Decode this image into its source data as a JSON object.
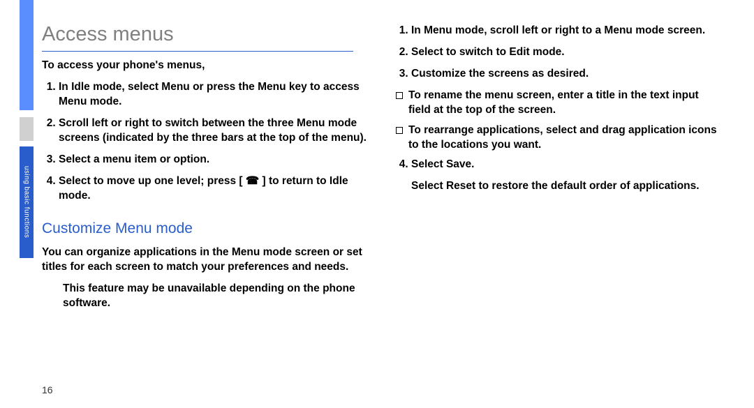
{
  "sideTab": "using basic functions",
  "pageNumber": "16",
  "left": {
    "heading": "Access menus",
    "intro": "To access your phone's menus,",
    "steps": [
      "In Idle mode, select Menu or press the Menu key to access Menu mode.",
      "Scroll left or right to switch between the three Menu mode screens (indicated by the three bars at the top of the menu).",
      "Select a menu item or option.",
      "Select      to move up one level; press [ ☎ ] to return to Idle mode."
    ],
    "subheading": "Customize Menu mode",
    "subBody": "You can organize applications in the Menu mode screen or set titles for each screen to match your preferences and needs.",
    "note": "This feature may be unavailable depending on the phone software."
  },
  "right": {
    "steps": [
      "In Menu mode, scroll left or right to a Menu mode screen.",
      "Select       to switch to Edit mode.",
      "Customize the screens as desired."
    ],
    "bullets": [
      "To rename the menu screen, enter a title in the text input field at the top of the screen.",
      "To rearrange applications, select and drag application icons to the locations you want."
    ],
    "step4": "Select Save.",
    "tail": "Select Reset to restore the default order of applications."
  }
}
